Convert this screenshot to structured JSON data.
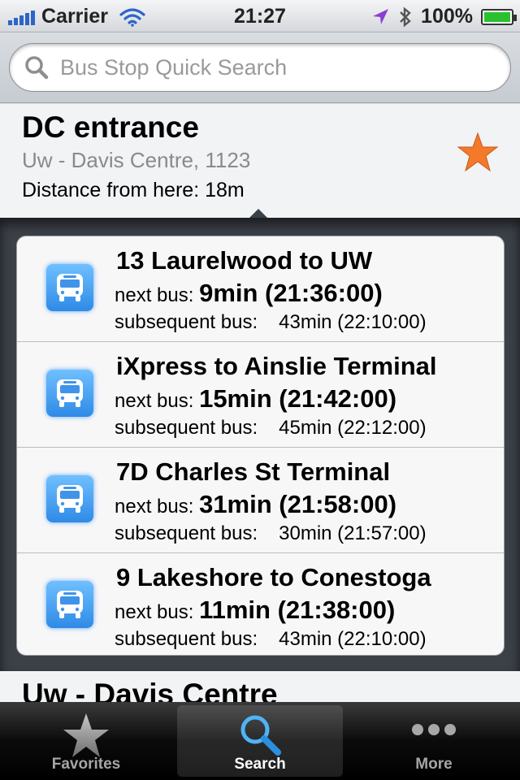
{
  "status_bar": {
    "carrier": "Carrier",
    "time": "21:27",
    "battery": "100%"
  },
  "search": {
    "placeholder": "Bus Stop Quick Search"
  },
  "stop": {
    "name": "DC entrance",
    "subtitle": "Uw - Davis Centre, 1123",
    "distance": "Distance from here: 18m",
    "favorite_color": "#f47a2a"
  },
  "routes": [
    {
      "title": "13 Laurelwood to UW",
      "next_label": "next bus:",
      "next_value": "9min (21:36:00)",
      "subsequent_label": "subsequent bus:",
      "subsequent_value": "43min (22:10:00)"
    },
    {
      "title": "iXpress to Ainslie Terminal",
      "next_label": "next bus:",
      "next_value": "15min (21:42:00)",
      "subsequent_label": "subsequent bus:",
      "subsequent_value": "45min (22:12:00)"
    },
    {
      "title": "7D Charles St Terminal",
      "next_label": "next bus:",
      "next_value": "31min (21:58:00)",
      "subsequent_label": "subsequent bus:",
      "subsequent_value": "30min (21:57:00)"
    },
    {
      "title": "9 Lakeshore to Conestoga",
      "next_label": "next bus:",
      "next_value": "11min (21:38:00)",
      "subsequent_label": "subsequent bus:",
      "subsequent_value": "43min (22:10:00)"
    }
  ],
  "next_stop": {
    "name": "Uw - Davis Centre"
  },
  "tabs": {
    "favorites": "Favorites",
    "search": "Search",
    "more": "More"
  },
  "icons": {
    "signal": "signal-bars-icon",
    "wifi": "wifi-icon",
    "location": "location-arrow-icon",
    "bluetooth": "bluetooth-icon",
    "battery": "battery-charging-icon",
    "search": "magnifier-icon",
    "bus": "bus-icon",
    "favorite": "star-icon",
    "more": "ellipsis-icon"
  }
}
